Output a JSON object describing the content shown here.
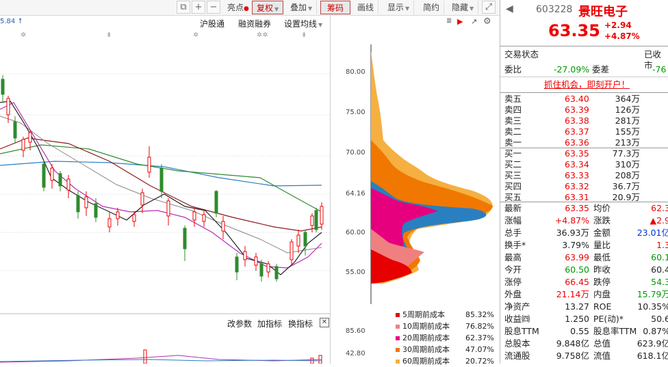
{
  "toolbar": {
    "buttons": [
      "亮点",
      "复权",
      "叠加",
      "筹码",
      "画线",
      "显示",
      "简约",
      "隐藏"
    ],
    "icon_plus": "+",
    "icon_minus": "−"
  },
  "chart": {
    "top_left_value": "5.84",
    "header_links": [
      "沪股通",
      "融资融券",
      "设置均线"
    ],
    "indicator_links": [
      "改参数",
      "加指标",
      "换指标"
    ]
  },
  "chip_axis": {
    "ticks": [
      "80.00",
      "75.00",
      "70.00",
      "64.16",
      "60.00",
      "55.00"
    ],
    "bottom_ticks": [
      "85.60",
      "42.80"
    ]
  },
  "chip_legend": [
    {
      "label": "5周期前成本",
      "pct": "85.32%",
      "color": "#e60000"
    },
    {
      "label": "10周期前成本",
      "pct": "76.82%",
      "color": "#f08080"
    },
    {
      "label": "20周期前成本",
      "pct": "62.37%",
      "color": "#e6007e"
    },
    {
      "label": "30周期前成本",
      "pct": "47.07%",
      "color": "#f07800"
    },
    {
      "label": "60周期前成本",
      "pct": "20.72%",
      "color": "#f5b041"
    }
  ],
  "stock": {
    "code": "603228",
    "name": "景旺电子",
    "price": "63.35",
    "change": "+2.94",
    "change_pct": "+4.87%",
    "trade_status_label": "交易状态",
    "trade_status": "已收市",
    "weibi_label": "委比",
    "weibi": "-27.09%",
    "weicha_label": "委差",
    "weicha": "-76",
    "promo": "抓住机会，即刻开户！"
  },
  "order_book": {
    "sell": [
      {
        "label": "卖五",
        "price": "63.40",
        "vol": "364万"
      },
      {
        "label": "卖四",
        "price": "63.39",
        "vol": "126万"
      },
      {
        "label": "卖三",
        "price": "63.38",
        "vol": "281万"
      },
      {
        "label": "卖二",
        "price": "63.37",
        "vol": "155万"
      },
      {
        "label": "卖一",
        "price": "63.36",
        "vol": "213万"
      }
    ],
    "buy": [
      {
        "label": "买一",
        "price": "63.35",
        "vol": "77.3万"
      },
      {
        "label": "买二",
        "price": "63.34",
        "vol": "310万"
      },
      {
        "label": "买三",
        "price": "63.33",
        "vol": "208万"
      },
      {
        "label": "买四",
        "price": "63.32",
        "vol": "36.7万"
      },
      {
        "label": "买五",
        "price": "63.31",
        "vol": "20.9万"
      }
    ]
  },
  "stats": [
    {
      "l1": "最新",
      "v1": "63.35",
      "c1": "red",
      "l2": "均价",
      "v2": "62.3",
      "c2": "red"
    },
    {
      "l1": "涨幅",
      "v1": "+4.87%",
      "c1": "red",
      "l2": "涨跌",
      "v2": "▲2.9",
      "c2": "red"
    },
    {
      "l1": "总手",
      "v1": "36.93万",
      "c1": "black",
      "l2": "金额",
      "v2": "23.01亿",
      "c2": "blue"
    },
    {
      "l1": "换手*",
      "v1": "3.79%",
      "c1": "black",
      "l2": "量比",
      "v2": "1.3",
      "c2": "red"
    },
    {
      "l1": "最高",
      "v1": "63.99",
      "c1": "red",
      "l2": "最低",
      "v2": "60.1",
      "c2": "green"
    },
    {
      "l1": "今开",
      "v1": "60.50",
      "c1": "green",
      "l2": "昨收",
      "v2": "60.4",
      "c2": "black"
    },
    {
      "l1": "涨停",
      "v1": "66.45",
      "c1": "red",
      "l2": "跌停",
      "v2": "54.3",
      "c2": "green"
    },
    {
      "l1": "外盘",
      "v1": "21.14万",
      "c1": "red",
      "l2": "内盘",
      "v2": "15.79万",
      "c2": "green"
    },
    {
      "l1": "净资产",
      "v1": "13.27",
      "c1": "black",
      "l2": "ROE",
      "v2": "10.35%",
      "c2": "black"
    },
    {
      "l1": "收益㈣",
      "v1": "1.250",
      "c1": "black",
      "l2": "PE(动)*",
      "v2": "50.6",
      "c2": "black"
    },
    {
      "l1": "股息TTM",
      "v1": "0.55",
      "c1": "black",
      "l2": "股息率TTM",
      "v2": "0.87%",
      "c2": "black"
    },
    {
      "l1": "总股本",
      "v1": "9.848亿",
      "c1": "black",
      "l2": "总值",
      "v2": "623.9亿",
      "c2": "black"
    },
    {
      "l1": "流通股",
      "v1": "9.758亿",
      "c1": "black",
      "l2": "流值",
      "v2": "618.1亿",
      "c2": "black"
    }
  ]
}
